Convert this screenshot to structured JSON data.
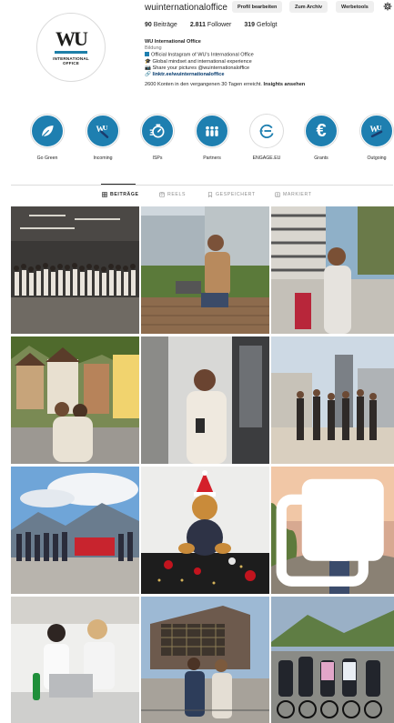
{
  "profile": {
    "username": "wuinternationaloffice",
    "avatar": {
      "logo_text": "WU",
      "logo_sub_line1": "INTERNATIONAL",
      "logo_sub_line2": "OFFICE"
    },
    "buttons": {
      "edit": "Profil bearbeiten",
      "archive": "Zum Archiv",
      "tools": "Werbetools"
    },
    "stats": {
      "posts_count": "90",
      "posts_label": "Beiträge",
      "followers_count": "2.811",
      "followers_label": "Follower",
      "following_count": "319",
      "following_label": "Gefolgt"
    },
    "bio": {
      "name": "WU International Office",
      "category": "Bildung",
      "line1": "Official Instagram of WU's International Office",
      "line2": "Global mindset and  international experience",
      "line3": "Share your pictures @wuinternationaloffice",
      "link": "linktr.ee/wuinternationaloffice",
      "reach_text": "2600 Konten in den vergangenen 30 Tagen erreicht.",
      "reach_link": "Insights ansehen"
    }
  },
  "highlights": [
    {
      "label": "Go Green",
      "icon": "leaf-icon"
    },
    {
      "label": "Incoming",
      "icon": "wu-arrow-icon"
    },
    {
      "label": "ISPs",
      "icon": "stopwatch-icon"
    },
    {
      "label": "Partners",
      "icon": "people-icon"
    },
    {
      "label": "ENGAGE.EU",
      "icon": "engage-logo-icon"
    },
    {
      "label": "Grants",
      "icon": "euro-icon"
    },
    {
      "label": "Outgoing",
      "icon": "wu-arrow-out-icon"
    }
  ],
  "tabs": [
    {
      "label": "BEITRÄGE",
      "icon": "grid-icon",
      "active": true
    },
    {
      "label": "REELS",
      "icon": "reels-icon",
      "active": false
    },
    {
      "label": "GESPEICHERT",
      "icon": "bookmark-icon",
      "active": false
    },
    {
      "label": "MARKIERT",
      "icon": "tag-icon",
      "active": false
    }
  ],
  "colors": {
    "accent": "#1e7fb0",
    "link": "#00376b",
    "button_bg": "#efefef",
    "border": "#dbdbdb"
  }
}
